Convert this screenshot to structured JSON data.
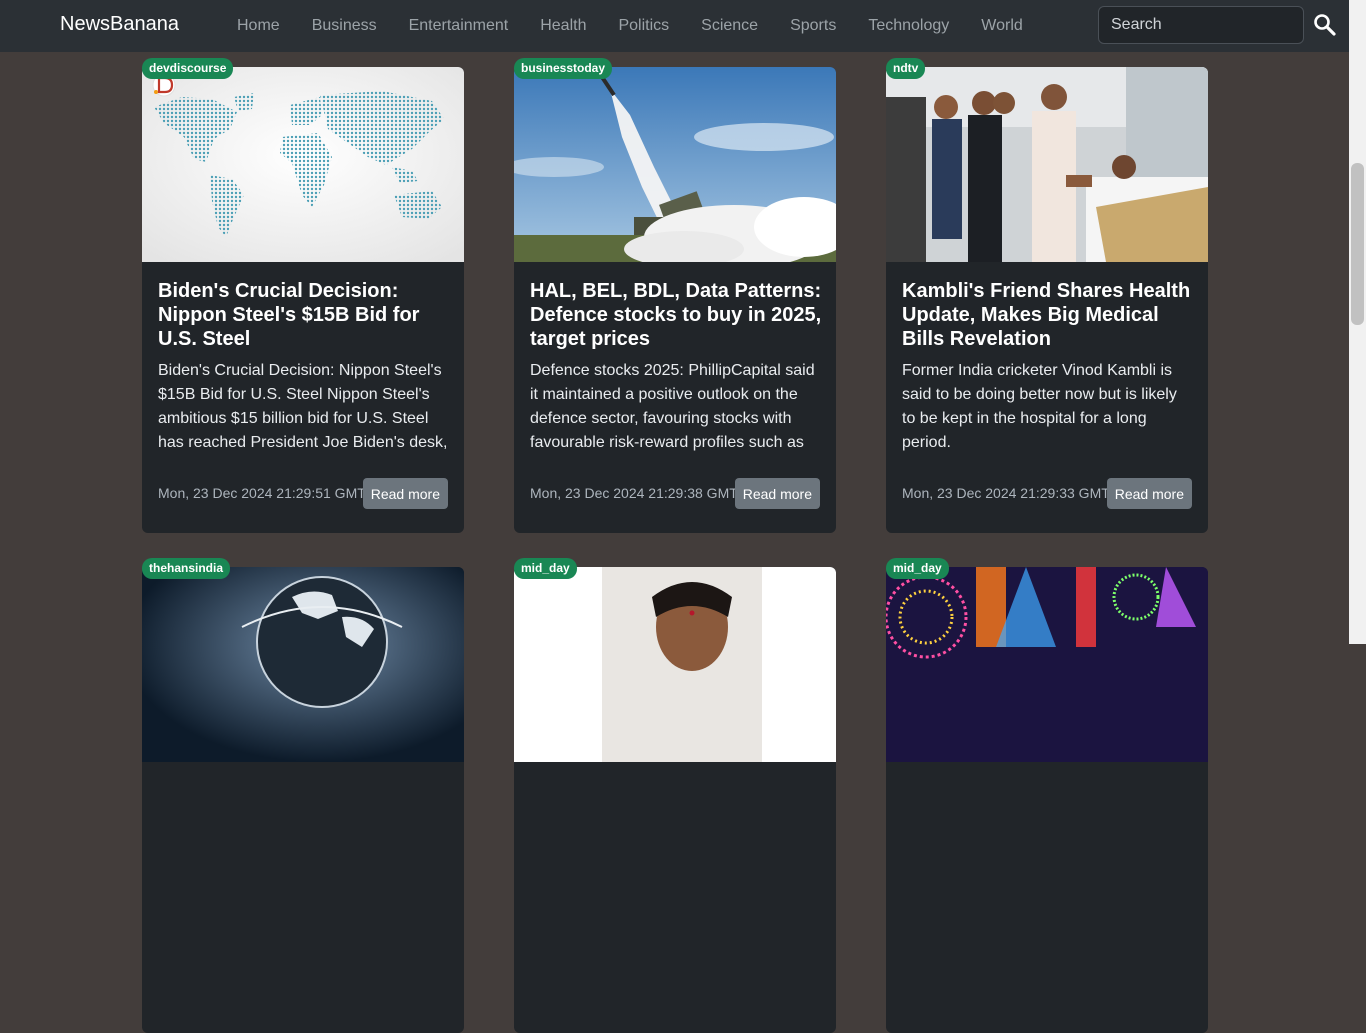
{
  "nav": {
    "brand": "NewsBanana",
    "links": [
      "Home",
      "Business",
      "Entertainment",
      "Health",
      "Politics",
      "Science",
      "Sports",
      "Technology",
      "World"
    ],
    "search_placeholder": "Search",
    "search_icon": "search-icon"
  },
  "cards": [
    {
      "source": "devdiscourse",
      "title": "Biden's Crucial Decision: Nippon Steel's $15B Bid for U.S. Steel",
      "description": "Biden's Crucial Decision: Nippon Steel's $15B Bid for U.S. Steel Nippon Steel's ambitious $15 billion bid for U.S. Steel has reached President Joe Biden's desk,",
      "date": "Mon, 23 Dec 2024 21:29:51 GMT",
      "button": "Read more"
    },
    {
      "source": "businesstoday",
      "title": "HAL, BEL, BDL, Data Patterns: Defence stocks to buy in 2025, target prices",
      "description": "Defence stocks 2025: PhillipCapital said it maintained a positive outlook on the defence sector, favouring stocks with favourable risk-reward profiles such as",
      "date": "Mon, 23 Dec 2024 21:29:38 GMT",
      "button": "Read more"
    },
    {
      "source": "ndtv",
      "title": "Kambli's Friend Shares Health Update, Makes Big Medical Bills Revelation",
      "description": "Former India cricketer Vinod Kambli is said to be doing better now but is likely to be kept in the hospital for a long period.",
      "date": "Mon, 23 Dec 2024 21:29:33 GMT",
      "button": "Read more"
    },
    {
      "source": "thehansindia"
    },
    {
      "source": "mid_day"
    },
    {
      "source": "mid_day"
    }
  ],
  "colors": {
    "page_bg": "#433d3b",
    "navbar_bg": "#2b3035",
    "card_bg": "#212529",
    "badge_bg": "#198754",
    "button_bg": "#6c757d"
  }
}
